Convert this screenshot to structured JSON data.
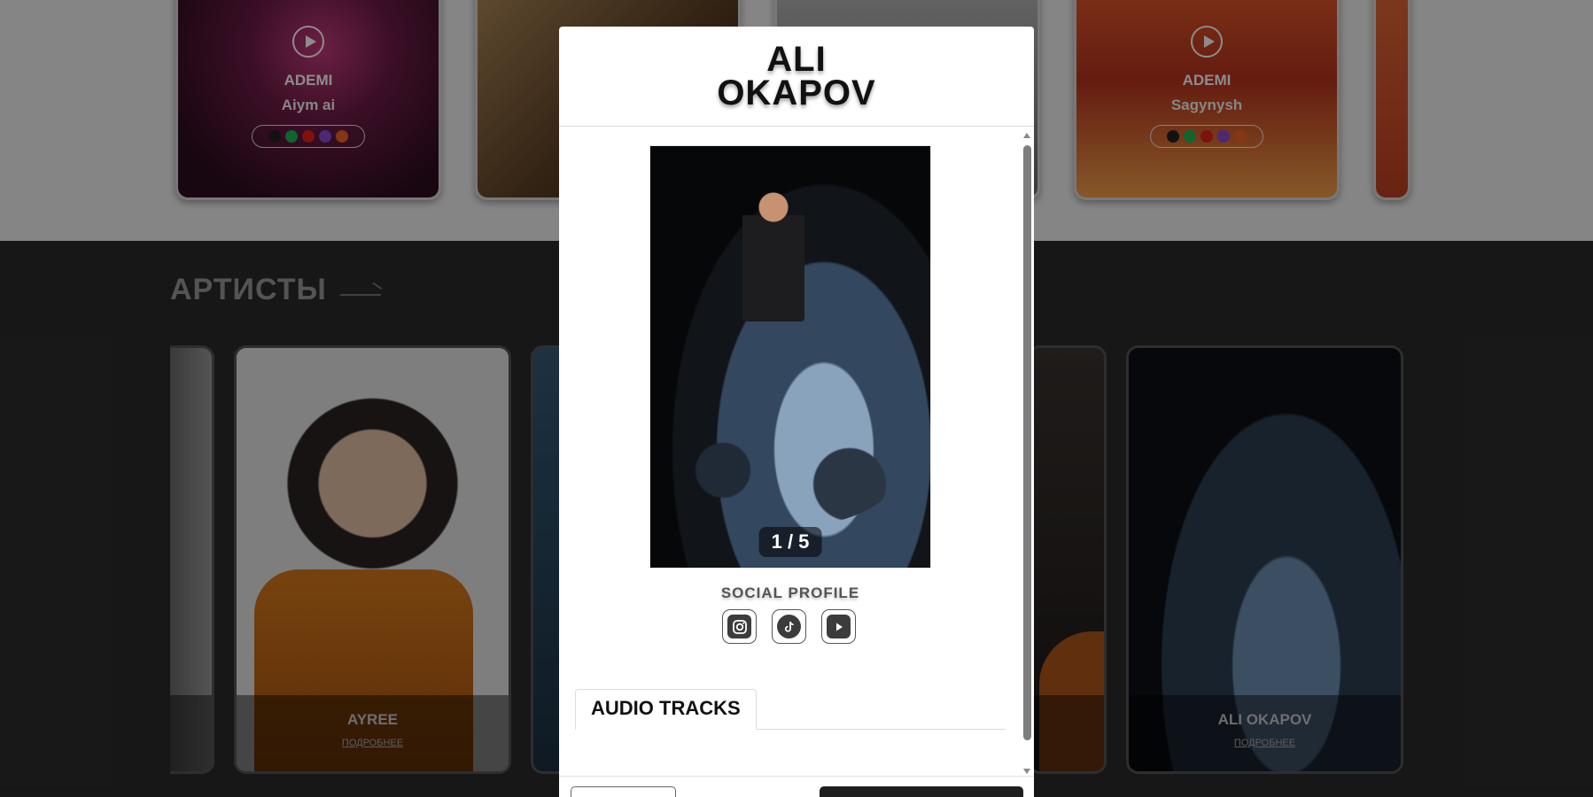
{
  "releases": [
    {
      "artist": "ADEMI",
      "song": "Aiym ai"
    },
    {
      "artist": "ADEMI",
      "song": "Sagynysh"
    }
  ],
  "section": {
    "title": "АРТИСТЫ"
  },
  "artists": [
    {
      "name": "AYREE",
      "more": "ПОДРОБНЕЕ"
    },
    {
      "name": "ALI OKAPOV",
      "more": "ПОДРОБНЕЕ"
    }
  ],
  "modal": {
    "title_line1": "ALI",
    "title_line2": "OKAPOV",
    "carousel": {
      "current": 1,
      "total": 5,
      "counter": "1 / 5"
    },
    "social_title": "SOCIAL PROFILE",
    "social": [
      "instagram-icon",
      "tiktok-icon",
      "youtube-icon"
    ],
    "tab_label": "AUDIO TRACKS",
    "scroll_fraction": 0
  },
  "colors": {
    "accent": "#1f1f1f",
    "background_dark": "#2b2b2b",
    "background_light": "#f2f2f2"
  }
}
